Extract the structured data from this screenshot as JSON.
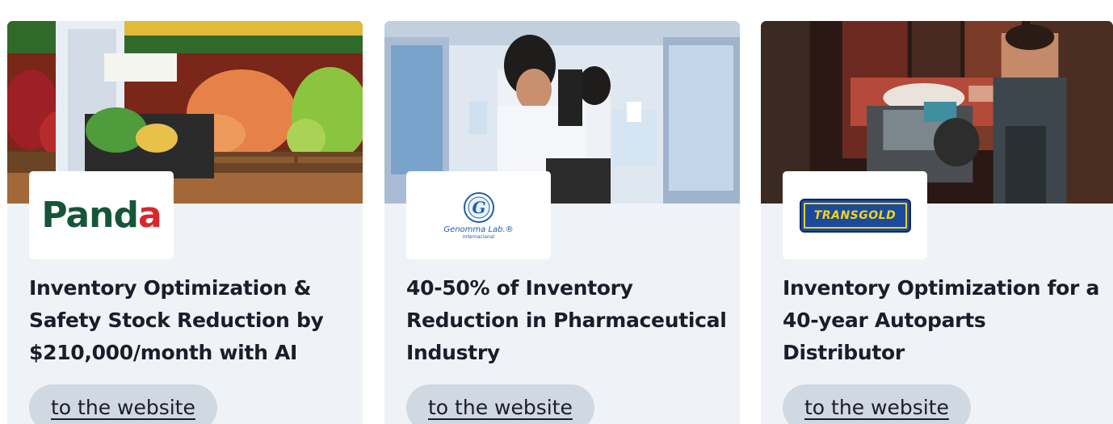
{
  "cards": [
    {
      "image_alt": "Shopper with basket in a supermarket produce aisle",
      "logo_text": "Panda",
      "title": "Inventory Optimization & Safety Stock Reduction by $210,000/month with AI",
      "button_label": "to the website"
    },
    {
      "image_alt": "Laboratory scientist looking into a microscope",
      "logo_text": "Genomma Lab.®",
      "logo_subtext": "Internacional",
      "title": "40-50% of Inventory Reduction in Pharmaceutical Industry",
      "button_label": "to the website"
    },
    {
      "image_alt": "Mechanic working on an engine in an auto garage",
      "logo_text": "TRANSGOLD",
      "title": "Inventory Optimization for a 40-year Autoparts Distributor",
      "button_label": "to the website"
    }
  ],
  "colors": {
    "card_background": "#eff3f8",
    "button_background": "#d0d8e2",
    "title_text": "#1c1c2a",
    "panda_green": "#16553a",
    "panda_red": "#d9262c",
    "genomma_blue": "#1f5fa8",
    "transgold_blue": "#1a4a9c",
    "transgold_yellow": "#f5d316"
  }
}
